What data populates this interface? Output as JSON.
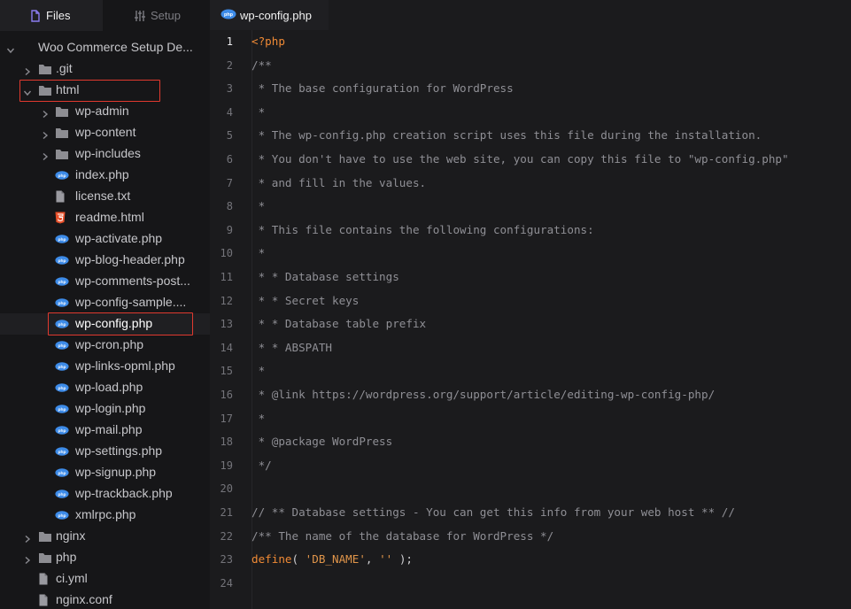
{
  "sidebar": {
    "tabs": [
      {
        "label": "Files",
        "icon": "file-icon",
        "active": true
      },
      {
        "label": "Setup",
        "icon": "sliders-icon",
        "active": false
      }
    ],
    "tree": [
      {
        "label": "Woo Commerce Setup De...",
        "type": "folder-root",
        "expanded": true,
        "depth": 0,
        "icon": "chevron-down-icon"
      },
      {
        "label": ".git",
        "type": "folder",
        "expanded": false,
        "depth": 1,
        "icon": "folder-icon"
      },
      {
        "label": "html",
        "type": "folder",
        "expanded": true,
        "depth": 1,
        "icon": "folder-icon",
        "highlighted": true
      },
      {
        "label": "wp-admin",
        "type": "folder",
        "expanded": false,
        "depth": 2,
        "icon": "folder-icon"
      },
      {
        "label": "wp-content",
        "type": "folder",
        "expanded": false,
        "depth": 2,
        "icon": "folder-icon"
      },
      {
        "label": "wp-includes",
        "type": "folder",
        "expanded": false,
        "depth": 2,
        "icon": "folder-icon"
      },
      {
        "label": "index.php",
        "type": "php",
        "depth": 2,
        "icon": "php-file-icon"
      },
      {
        "label": "license.txt",
        "type": "txt",
        "depth": 2,
        "icon": "text-file-icon"
      },
      {
        "label": "readme.html",
        "type": "html",
        "depth": 2,
        "icon": "html5-icon"
      },
      {
        "label": "wp-activate.php",
        "type": "php",
        "depth": 2,
        "icon": "php-file-icon"
      },
      {
        "label": "wp-blog-header.php",
        "type": "php",
        "depth": 2,
        "icon": "php-file-icon"
      },
      {
        "label": "wp-comments-post...",
        "type": "php",
        "depth": 2,
        "icon": "php-file-icon"
      },
      {
        "label": "wp-config-sample....",
        "type": "php",
        "depth": 2,
        "icon": "php-file-icon"
      },
      {
        "label": "wp-config.php",
        "type": "php",
        "depth": 2,
        "icon": "php-file-icon",
        "selected": true,
        "highlighted": true
      },
      {
        "label": "wp-cron.php",
        "type": "php",
        "depth": 2,
        "icon": "php-file-icon"
      },
      {
        "label": "wp-links-opml.php",
        "type": "php",
        "depth": 2,
        "icon": "php-file-icon"
      },
      {
        "label": "wp-load.php",
        "type": "php",
        "depth": 2,
        "icon": "php-file-icon"
      },
      {
        "label": "wp-login.php",
        "type": "php",
        "depth": 2,
        "icon": "php-file-icon"
      },
      {
        "label": "wp-mail.php",
        "type": "php",
        "depth": 2,
        "icon": "php-file-icon"
      },
      {
        "label": "wp-settings.php",
        "type": "php",
        "depth": 2,
        "icon": "php-file-icon"
      },
      {
        "label": "wp-signup.php",
        "type": "php",
        "depth": 2,
        "icon": "php-file-icon"
      },
      {
        "label": "wp-trackback.php",
        "type": "php",
        "depth": 2,
        "icon": "php-file-icon"
      },
      {
        "label": "xmlrpc.php",
        "type": "php",
        "depth": 2,
        "icon": "php-file-icon"
      },
      {
        "label": "nginx",
        "type": "folder",
        "expanded": false,
        "depth": 1,
        "icon": "folder-icon"
      },
      {
        "label": "php",
        "type": "folder",
        "expanded": false,
        "depth": 1,
        "icon": "folder-icon"
      },
      {
        "label": "ci.yml",
        "type": "txt",
        "depth": 1,
        "icon": "text-file-icon"
      },
      {
        "label": "nginx.conf",
        "type": "txt",
        "depth": 1,
        "icon": "text-file-icon"
      }
    ]
  },
  "editor": {
    "tab": {
      "label": "wp-config.php",
      "icon": "php-file-icon"
    },
    "active_line": 1,
    "lines": [
      {
        "n": "1",
        "parts": [
          {
            "t": "<?php",
            "c": "kw"
          }
        ]
      },
      {
        "n": "2",
        "parts": [
          {
            "t": "/**",
            "c": "cmt"
          }
        ]
      },
      {
        "n": "3",
        "parts": [
          {
            "t": " * The base configuration for WordPress",
            "c": "cmt"
          }
        ]
      },
      {
        "n": "4",
        "parts": [
          {
            "t": " *",
            "c": "cmt"
          }
        ]
      },
      {
        "n": "5",
        "parts": [
          {
            "t": " * The wp-config.php creation script uses this file during the installation.",
            "c": "cmt"
          }
        ]
      },
      {
        "n": "6",
        "parts": [
          {
            "t": " * You don't have to use the web site, you can copy this file to \"wp-config.php\"",
            "c": "cmt"
          }
        ]
      },
      {
        "n": "7",
        "parts": [
          {
            "t": " * and fill in the values.",
            "c": "cmt"
          }
        ]
      },
      {
        "n": "8",
        "parts": [
          {
            "t": " *",
            "c": "cmt"
          }
        ]
      },
      {
        "n": "9",
        "parts": [
          {
            "t": " * This file contains the following configurations:",
            "c": "cmt"
          }
        ]
      },
      {
        "n": "10",
        "parts": [
          {
            "t": " *",
            "c": "cmt"
          }
        ]
      },
      {
        "n": "11",
        "parts": [
          {
            "t": " * * Database settings",
            "c": "cmt"
          }
        ]
      },
      {
        "n": "12",
        "parts": [
          {
            "t": " * * Secret keys",
            "c": "cmt"
          }
        ]
      },
      {
        "n": "13",
        "parts": [
          {
            "t": " * * Database table prefix",
            "c": "cmt"
          }
        ]
      },
      {
        "n": "14",
        "parts": [
          {
            "t": " * * ABSPATH",
            "c": "cmt"
          }
        ]
      },
      {
        "n": "15",
        "parts": [
          {
            "t": " *",
            "c": "cmt"
          }
        ]
      },
      {
        "n": "16",
        "parts": [
          {
            "t": " * @link https://wordpress.org/support/article/editing-wp-config-php/",
            "c": "cmt"
          }
        ]
      },
      {
        "n": "17",
        "parts": [
          {
            "t": " *",
            "c": "cmt"
          }
        ]
      },
      {
        "n": "18",
        "parts": [
          {
            "t": " * @package WordPress",
            "c": "cmt"
          }
        ]
      },
      {
        "n": "19",
        "parts": [
          {
            "t": " */",
            "c": "cmt"
          }
        ]
      },
      {
        "n": "20",
        "parts": []
      },
      {
        "n": "21",
        "parts": [
          {
            "t": "// ** Database settings - You can get this info from your web host ** //",
            "c": "cmt"
          }
        ]
      },
      {
        "n": "22",
        "parts": [
          {
            "t": "/** The name of the database for WordPress */",
            "c": "cmt"
          }
        ]
      },
      {
        "n": "23",
        "parts": [
          {
            "t": "define",
            "c": "kw"
          },
          {
            "t": "( ",
            "c": "plain"
          },
          {
            "t": "'DB_NAME'",
            "c": "str"
          },
          {
            "t": ", ",
            "c": "plain"
          },
          {
            "t": "''",
            "c": "str"
          },
          {
            "t": " );",
            "c": "plain"
          }
        ]
      },
      {
        "n": "24",
        "parts": []
      }
    ]
  },
  "colors": {
    "highlight_box": "#e0392f",
    "keyword": "#f08a35",
    "php_icon": "#3d8be8",
    "html_icon": "#e8502a",
    "files_icon": "#8b7cf0"
  }
}
